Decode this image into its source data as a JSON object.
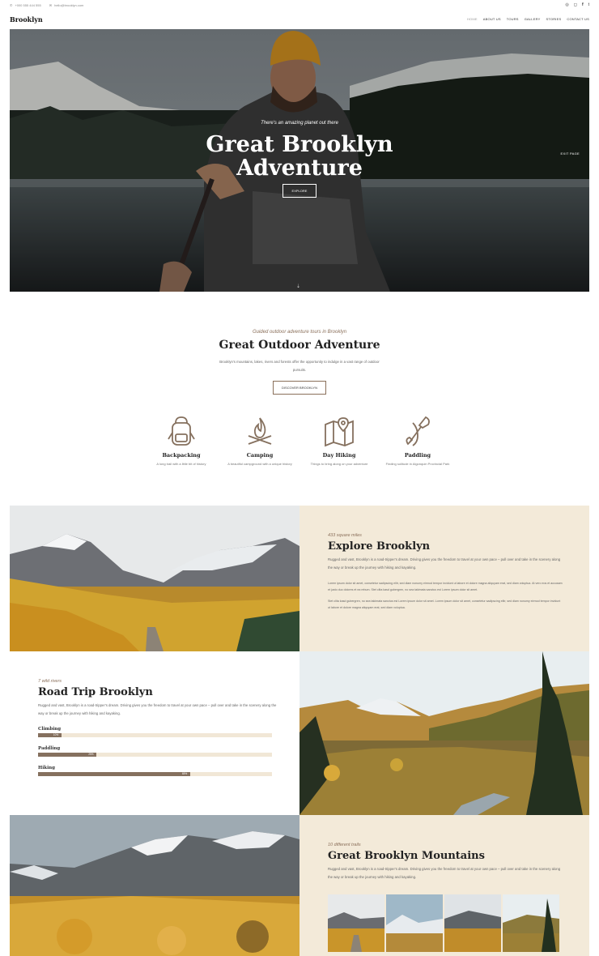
{
  "topbar": {
    "phone": "+000 555 444 555",
    "email": "hello@brooklyn.com",
    "social_icons": [
      "dribbble-icon",
      "instagram-icon",
      "facebook-icon",
      "twitter-icon"
    ]
  },
  "nav": {
    "brand": "Brooklyn",
    "items": [
      "HOME",
      "ABOUT US",
      "TOURS",
      "GALLERY",
      "STORIES",
      "CONTACT US"
    ]
  },
  "hero": {
    "tagline": "There's an amazing planet out there",
    "title_line1": "Great Brooklyn",
    "title_line2": "Adventure",
    "button": "EXPLORE",
    "exit": "EXIT PAGE",
    "scroll_icon": "scroll-down-icon"
  },
  "intro": {
    "kicker": "Guided outdoor adventure tours in Brooklyn",
    "title": "Great Outdoor Adventure",
    "text": "Brooklyn's mountains, lakes, rivers and forests offer the opportunity to indulge in a vast range of outdoor pursuits.",
    "button": "DISCOVER BROOKLYN",
    "features": [
      {
        "title": "Backpacking",
        "desc": "A long trail with a little bit of history",
        "icon": "backpack-icon"
      },
      {
        "title": "Camping",
        "desc": "A beautiful campground with a unique history",
        "icon": "campfire-icon"
      },
      {
        "title": "Day Hiking",
        "desc": "Things to bring along on your adventure",
        "icon": "map-icon"
      },
      {
        "title": "Paddling",
        "desc": "Finding solitude in Algonquin Provincial Park",
        "icon": "paddle-icon"
      }
    ]
  },
  "explore": {
    "kicker": "433 square miles",
    "title": "Explore Brooklyn",
    "text": "Rugged and vast, Brooklyn is a road-tripper's dream. Driving gives you the freedom to travel at your own pace – pull over and take in the scenery along the way or break up the journey with hiking and kayaking.",
    "lorem1": "Lorem ipsum dolor sit amet, consetetur sadipscing elitr, sed diam nonumy eirmod tempor invidunt ut labore et dolore magna aliquyam erat, sed diam voluptua. At vero eos et accusam et justo duo dolores et ea rebum. Stet clita kasd gubergren, no sea takimata sanctus est Lorem ipsum dolor sit amet.",
    "lorem2": "Stet clita kasd gubergren, no sea takimata sanctus est Lorem ipsum dolor sit amet. Lorem ipsum dolor sit amet, consetetur sadipscing elitr, sed diam nonumy eirmod tempor invidunt ut labore et dolore magna aliquyam erat, sed diam voluptua."
  },
  "roadtrip": {
    "kicker": "7 wild rivers",
    "title": "Road Trip Brooklyn",
    "text": "Rugged and vast, Brooklyn is a road-tripper's dream. Driving gives you the freedom to travel at your own pace – pull over and take in the scenery along the way or break up the journey with hiking and kayaking.",
    "skills": [
      {
        "label": "Climbing",
        "pct": "10%",
        "value": 0.1
      },
      {
        "label": "Paddling",
        "pct": "25%",
        "value": 0.25
      },
      {
        "label": "Hiking",
        "pct": "65%",
        "value": 0.65
      }
    ]
  },
  "mountains": {
    "kicker": "10 different trails",
    "title": "Great Brooklyn Mountains",
    "text": "Rugged and vast, Brooklyn is a road-tripper's dream. Driving gives you the freedom to travel at your own pace – pull over and take in the scenery along the way or break up the journey with hiking and kayaking."
  },
  "colors": {
    "accent": "#85705e",
    "beige": "#f3ead9",
    "dark": "#222222"
  }
}
